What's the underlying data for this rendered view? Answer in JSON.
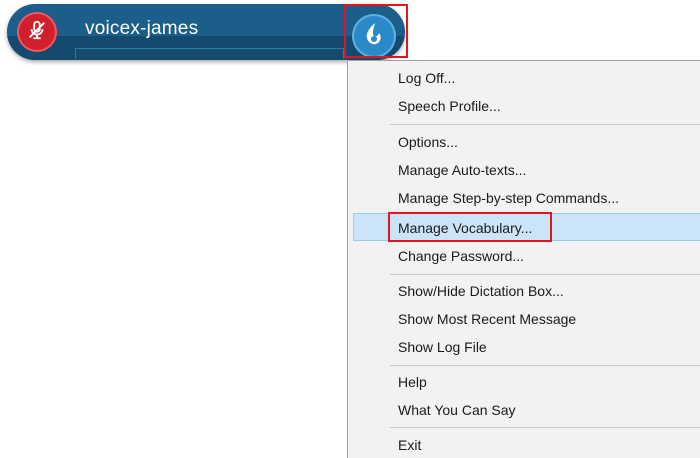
{
  "dictation_bar": {
    "username": "voicex-james",
    "icons": {
      "microphone": "microphone-muted-icon",
      "logo": "dragon-flame-logo-icon"
    },
    "colors": {
      "bar": "#1b5e8a",
      "mic": "#d11f2c",
      "logo": "#2a8ac7",
      "highlight": "#e0161c"
    }
  },
  "menu": {
    "items": [
      {
        "label": "Log Off..."
      },
      {
        "label": "Speech Profile..."
      },
      {
        "label": "Options..."
      },
      {
        "label": "Manage Auto-texts..."
      },
      {
        "label": "Manage Step-by-step Commands..."
      },
      {
        "label": "Manage Vocabulary...",
        "selected": true
      },
      {
        "label": "Change Password..."
      },
      {
        "label": "Show/Hide Dictation Box..."
      },
      {
        "label": "Show Most Recent Message"
      },
      {
        "label": "Show Log File"
      },
      {
        "label": "Help"
      },
      {
        "label": "What You Can Say"
      },
      {
        "label": "Exit"
      }
    ],
    "selected_color": "#cce4f7"
  }
}
